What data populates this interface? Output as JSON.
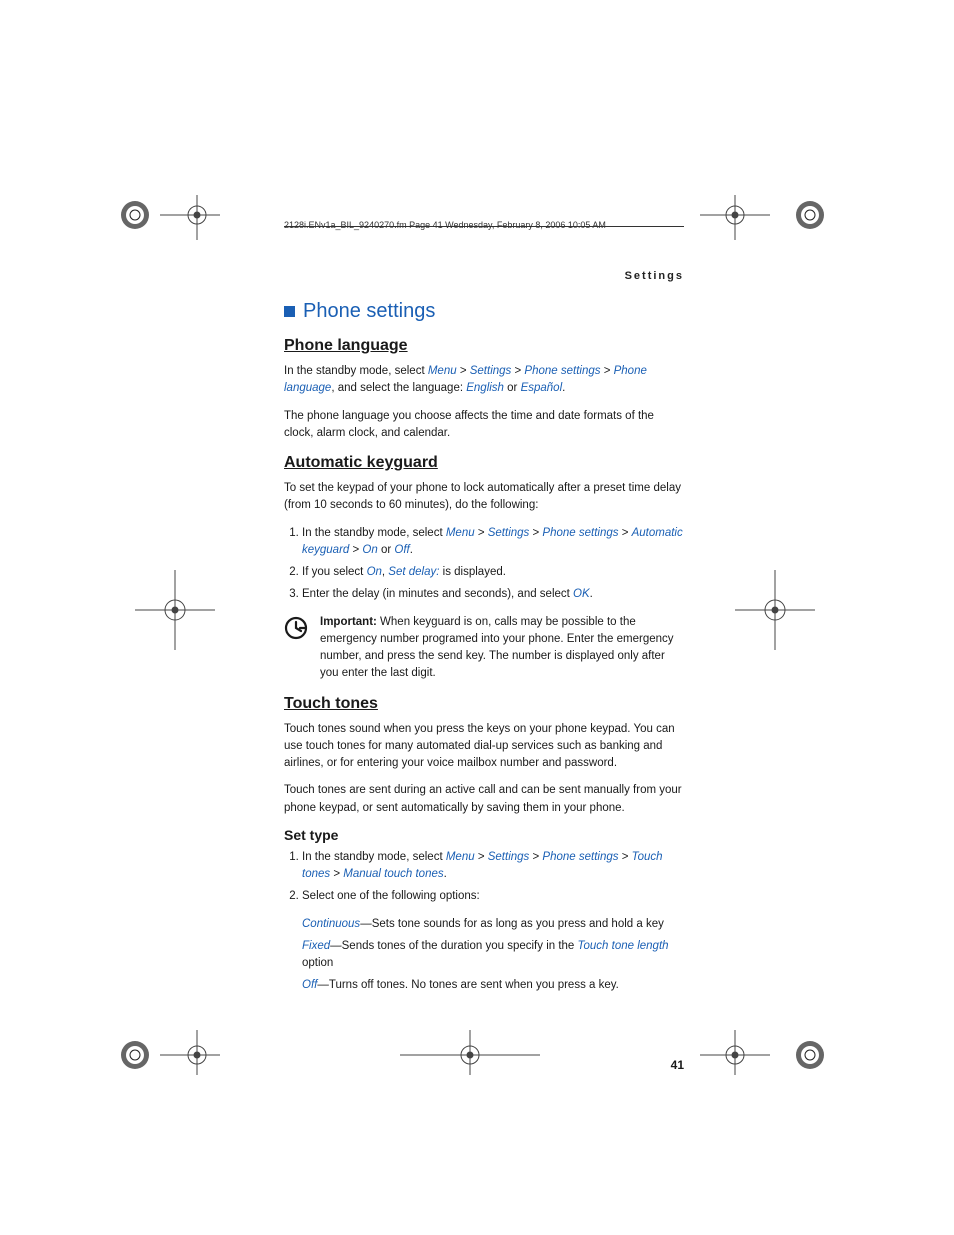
{
  "header_line": "2128i.ENv1a_BIL_9240270.fm  Page 41  Wednesday, February 8, 2006  10:05 AM",
  "running_head": "Settings",
  "section_title": "Phone settings",
  "phone_language": {
    "heading": "Phone language",
    "para1_a": "In the standby mode, select ",
    "menu": "Menu",
    "gt": " > ",
    "settings": "Settings",
    "phone_settings": "Phone settings",
    "phone_language": "Phone language",
    "para1_b": ", and select the language: ",
    "english": "English",
    "or": " or ",
    "espanol": "Español",
    "dot": ".",
    "para2": "The phone language you choose affects the time and date formats of the clock, alarm clock, and calendar."
  },
  "automatic_keyguard": {
    "heading": "Automatic keyguard",
    "intro": "To set the keypad of your phone to lock automatically after a preset time delay (from 10 seconds to 60 minutes), do the following:",
    "step1_a": "In the standby mode, select ",
    "menu": "Menu",
    "settings": "Settings",
    "phone_settings": "Phone settings",
    "auto_kg": "Automatic keyguard",
    "on": "On",
    "off": "Off",
    "step1_b": " > ",
    "or": " or ",
    "dot": ".",
    "step2_a": "If you select ",
    "step2_b": ", ",
    "set_delay": "Set delay:",
    "step2_c": " is displayed.",
    "step3_a": "Enter the delay (in minutes and seconds), and select ",
    "ok": "OK",
    "step3_b": ".",
    "important_label": "Important:",
    "important_text": " When keyguard is on, calls may be possible to the emergency number programed into your phone. Enter the emergency number, and press the send key. The number is displayed only after you enter the last digit."
  },
  "touch_tones": {
    "heading": "Touch tones",
    "p1": "Touch tones sound when you press the keys on your phone keypad. You can use touch tones for many automated dial-up services such as banking and airlines, or for entering your voice mailbox number and password.",
    "p2": "Touch tones are sent during an active call and can be sent manually from your phone keypad, or sent automatically by saving them in your phone.",
    "set_type": "Set type",
    "step1_a": "In the standby mode, select ",
    "menu": "Menu",
    "settings": "Settings",
    "phone_settings": "Phone settings",
    "touch_tones": "Touch tones",
    "gt": " > ",
    "manual": "Manual touch tones",
    "dot": ".",
    "step2": "Select one of the following options:",
    "cont": "Continuous",
    "cont_t": "—Sets tone sounds for as long as you press and hold a key",
    "fixed": "Fixed",
    "fixed_t1": "—Sends tones of the duration you specify in the ",
    "ttl": "Touch tone length",
    "fixed_t2": " option",
    "off": "Off",
    "off_t": "—Turns off tones. No tones are sent when you press a key."
  },
  "page_number": "41"
}
